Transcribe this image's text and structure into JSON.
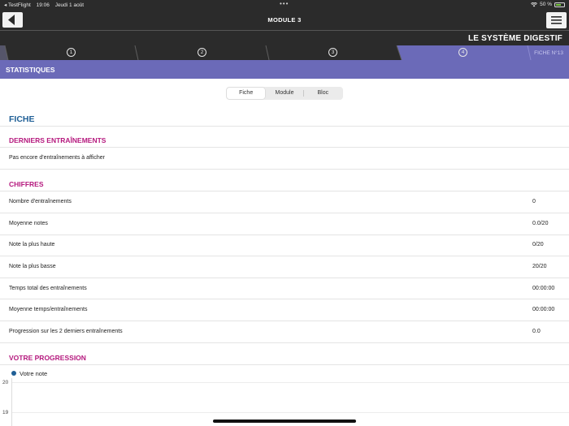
{
  "status_bar": {
    "app": "◂ TestFlight",
    "time": "19:06",
    "date": "Jeudi 1 août",
    "dots": "•••",
    "battery": "50 %",
    "battery_level": 0.5
  },
  "nav": {
    "title": "MODULE 3",
    "back_icon": "chevron-left-icon",
    "menu_icon": "hamburger-icon"
  },
  "subject": {
    "title": "LE SYSTÈME DIGESTIF"
  },
  "steps": {
    "items": [
      "1",
      "2",
      "3",
      "4"
    ],
    "active_index": 4,
    "fiche_label": "FICHE N°13"
  },
  "header": {
    "title": "STATISTIQUES"
  },
  "segmented": {
    "options": [
      "Fiche",
      "Module",
      "Bloc"
    ],
    "selected": "Fiche"
  },
  "fiche_title": "FICHE",
  "derniers": {
    "title": "DERNIERS ENTRAÎNEMENTS",
    "empty_text": "Pas encore d'entraînements à afficher"
  },
  "chiffres": {
    "title": "CHIFFRES",
    "rows": [
      {
        "label": "Nombre d'entraînements",
        "value": "0"
      },
      {
        "label": "Moyenne notes",
        "value": "0.0/20"
      },
      {
        "label": "Note la plus haute",
        "value": "0/20"
      },
      {
        "label": "Note la plus basse",
        "value": "20/20"
      },
      {
        "label": "Temps total des entraînements",
        "value": "00:00:00"
      },
      {
        "label": "Moyenne temps/entraînements",
        "value": "00:00:00"
      },
      {
        "label": "Progression sur les 2 derniers entraînements",
        "value": "0.0"
      }
    ]
  },
  "progression": {
    "title": "VOTRE PROGRESSION",
    "legend": "Votre note",
    "series_color": "#1f5f96",
    "y_ticks": [
      "20",
      "19"
    ]
  },
  "colors": {
    "dark_bar": "#2b2b2b",
    "accent_purple": "#6b6ab8",
    "title_blue": "#1f5f96",
    "section_magenta": "#b5197e"
  }
}
